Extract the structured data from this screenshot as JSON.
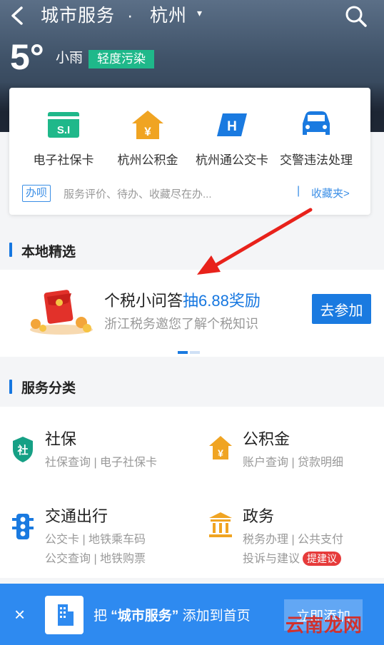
{
  "header": {
    "title": "城市服务",
    "dot": "·",
    "city": "杭州",
    "caret": "▾",
    "temperature": "5°",
    "weather": "小雨",
    "aqi": "轻度污染"
  },
  "quick_services": [
    {
      "label": "电子社保卡",
      "icon": "social-security-card-icon"
    },
    {
      "label": "杭州公积金",
      "icon": "housing-fund-icon"
    },
    {
      "label": "杭州通公交卡",
      "icon": "bus-card-icon"
    },
    {
      "label": "交警违法处理",
      "icon": "car-icon"
    }
  ],
  "hint": {
    "badge": "办呗",
    "text": "服务评价、待办、收藏尽在办...",
    "separator": "|",
    "favorites": "收藏夹>"
  },
  "local": {
    "section_title": "本地精选",
    "promo_title_part1": "个税小问答",
    "promo_title_highlight": "抽6.88奖励",
    "promo_subtitle": "浙江税务邀您了解个税知识",
    "join_label": "去参加"
  },
  "categories": {
    "section_title": "服务分类",
    "items": [
      {
        "name": "社保",
        "lines": [
          "社保查询 | 电子社保卡"
        ],
        "icon": "shield-icon"
      },
      {
        "name": "公积金",
        "lines": [
          "账户查询 | 贷款明细"
        ],
        "icon": "house-yen-icon"
      },
      {
        "name": "交通出行",
        "lines": [
          "公交卡 | 地铁乘车码",
          "公交查询 | 地铁购票"
        ],
        "icon": "traffic-light-icon"
      },
      {
        "name": "政务",
        "lines": [
          "税务办理 | 公共支付",
          "投诉与建议"
        ],
        "icon": "government-building-icon",
        "tag": "提建议"
      }
    ]
  },
  "bottom_bar": {
    "close": "×",
    "prefix": "把",
    "app_name": "“城市服务”",
    "suffix": "添加到首页",
    "button": "立即添加"
  },
  "watermark": "云南龙网",
  "colors": {
    "accent": "#1677e0",
    "aqi_badge": "#1fb88a",
    "suggest_tag": "#e63b3b",
    "bottom_bar": "#2e8af0",
    "annotation_arrow": "#e8221b"
  }
}
